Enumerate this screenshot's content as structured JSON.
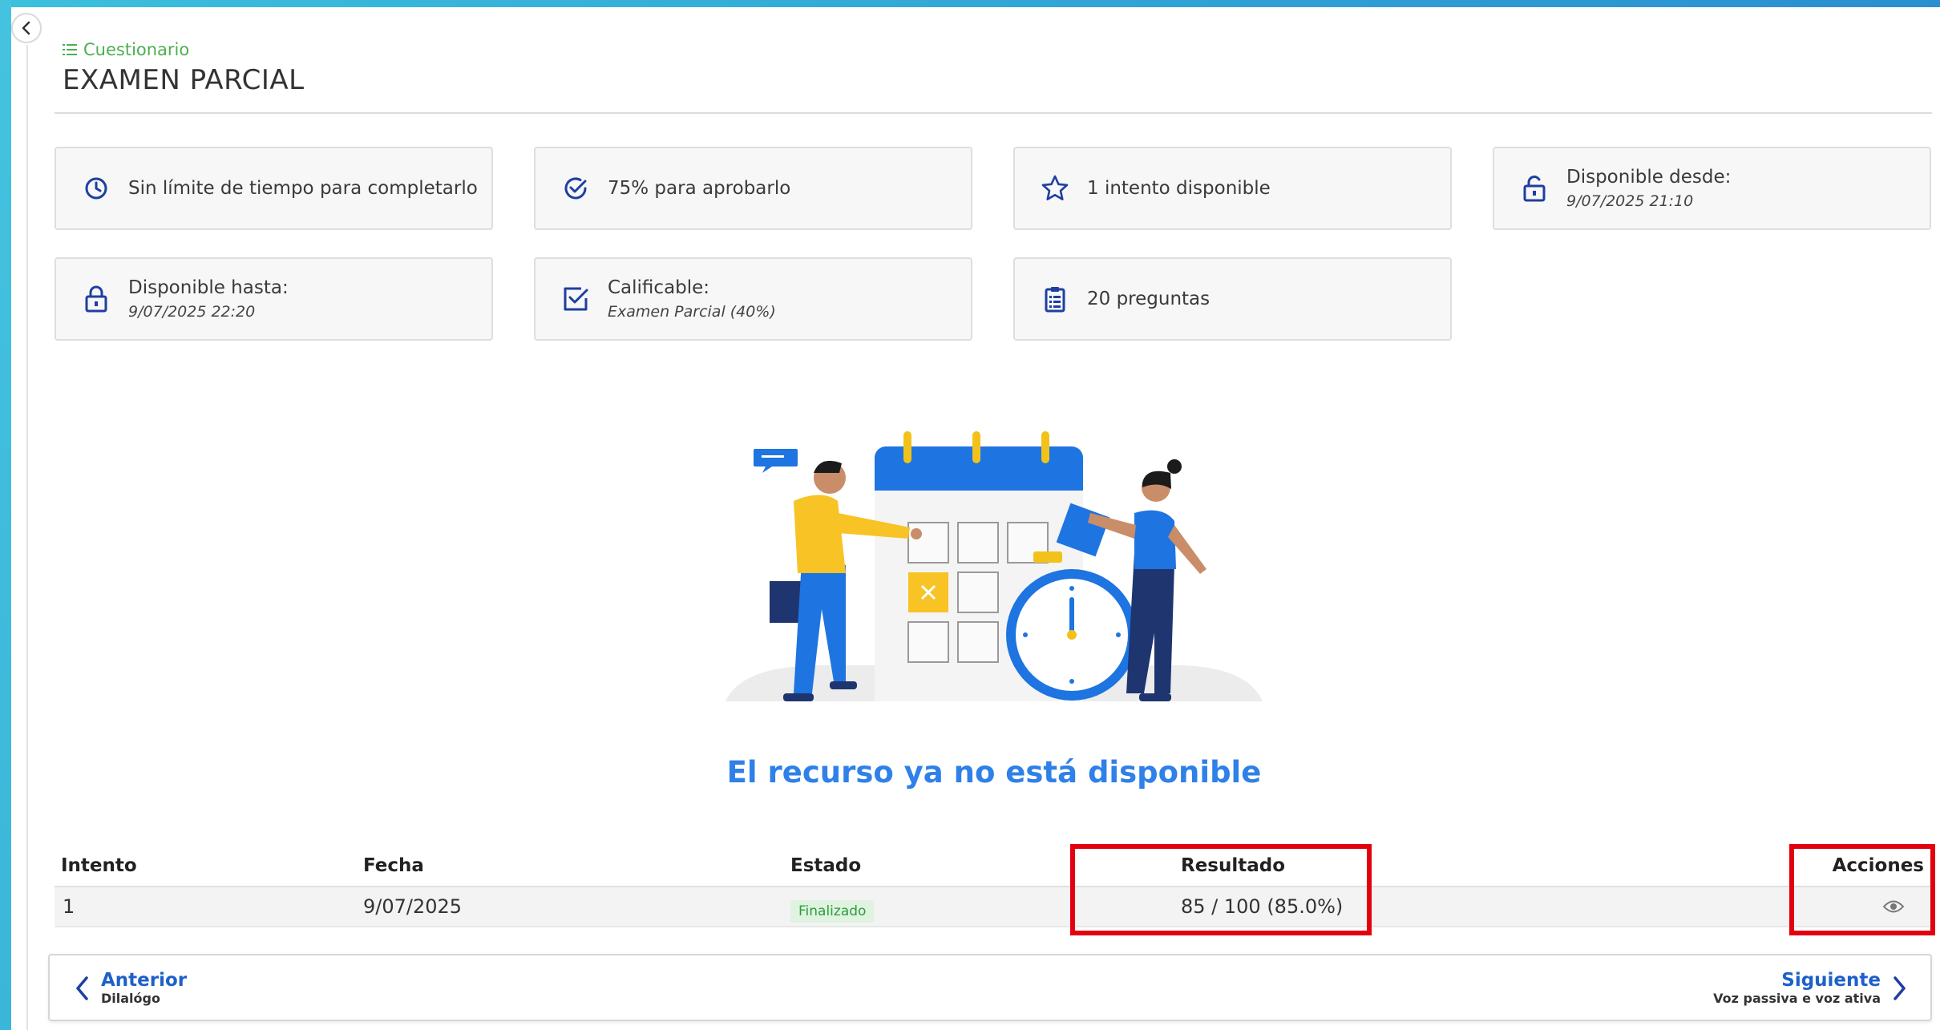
{
  "header": {
    "breadcrumb": "Cuestionario",
    "title": "EXAMEN PARCIAL"
  },
  "cards": {
    "time": "Sin límite de tiempo para completarlo",
    "pass": "75% para aprobarlo",
    "attempts": "1 intento disponible",
    "from_label": "Disponible desde:",
    "from_value": "9/07/2025 21:10",
    "until_label": "Disponible hasta:",
    "until_value": "9/07/2025 22:20",
    "gradable_label": "Calificable:",
    "gradable_value": "Examen Parcial (40%)",
    "questions": "20 preguntas"
  },
  "message": "El recurso ya no está disponible",
  "table": {
    "headers": {
      "attempt": "Intento",
      "date": "Fecha",
      "status": "Estado",
      "result": "Resultado",
      "actions": "Acciones"
    },
    "rows": [
      {
        "attempt": "1",
        "date": "9/07/2025",
        "status": "Finalizado",
        "result": "85 / 100 (85.0%)"
      }
    ]
  },
  "footer": {
    "prev_label": "Anterior",
    "prev_sub": "Dilalógo",
    "next_label": "Siguiente",
    "next_sub": "Voz passiva e voz ativa"
  },
  "colors": {
    "accent_blue": "#2f80e8",
    "icon_blue": "#1e3fa0",
    "breadcrumb_green": "#4caf50",
    "highlight_red": "#e3000f",
    "frame_cyan": "#3cc0dc"
  },
  "icons": {
    "collapse": "chevron-left-icon",
    "breadcrumb": "list-icon",
    "time": "clock-icon",
    "pass": "check-circle-icon",
    "attempts": "star-icon",
    "from": "unlock-icon",
    "until": "lock-icon",
    "gradable": "checkbox-icon",
    "questions": "clipboard-list-icon",
    "view": "eye-icon",
    "prev": "chevron-left-icon",
    "next": "chevron-right-icon"
  }
}
